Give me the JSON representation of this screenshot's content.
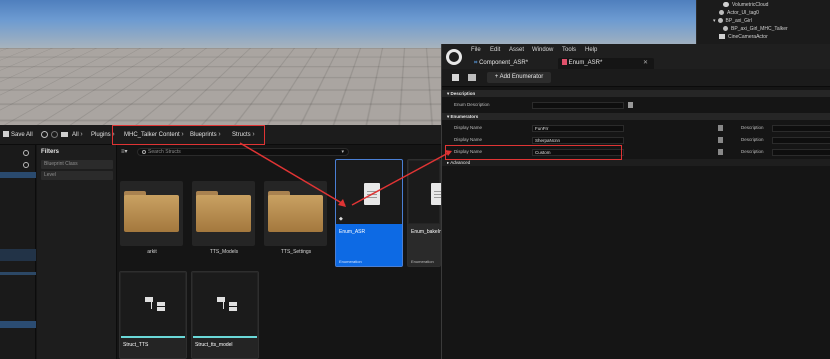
{
  "outliner": {
    "items": [
      {
        "label": "VolumetricCloud"
      },
      {
        "label": "Actor_UI_tag0"
      },
      {
        "label": "BP_axi_Girl"
      },
      {
        "label": "BP_axi_Girl_MHC_Talker"
      },
      {
        "label": "CineCameraActor"
      }
    ]
  },
  "content_browser": {
    "save_all": "Save All",
    "breadcrumb": [
      "All",
      "Plugins",
      "MHC_Talker Content",
      "Blueprints",
      "Structs"
    ],
    "filters_title": "Filters",
    "filter_items": [
      "Blueprint Class",
      "Level"
    ],
    "search_placeholder": "Search Structs",
    "folders": [
      {
        "label": "arkit"
      },
      {
        "label": "TTS_Models"
      },
      {
        "label": "TTS_Settings"
      }
    ],
    "assets": [
      {
        "name": "Enum_ASR",
        "type": "Enumeration",
        "selected": true
      },
      {
        "name": "Enum_bakeInf",
        "type": "Enumeration",
        "selected": false
      },
      {
        "name": "Struct_TTS",
        "type": "",
        "selected": false
      },
      {
        "name": "Struct_tts_model",
        "type": "",
        "selected": false
      }
    ]
  },
  "editor": {
    "menu": [
      "File",
      "Edit",
      "Asset",
      "Window",
      "Tools",
      "Help"
    ],
    "tabs": [
      {
        "label": "Component_ASR*"
      },
      {
        "label": "Enum_ASR*"
      }
    ],
    "add_button": "+ Add Enumerator",
    "sections": {
      "description": "Description",
      "enumerators": "Enumerators",
      "advanced": "Advanced"
    },
    "enum_description_label": "Enum Description",
    "display_name_label": "Display Name",
    "description_label": "Description",
    "enumerators": [
      {
        "display_name": "FunFrr"
      },
      {
        "display_name": "SherpaNcnn"
      },
      {
        "display_name": "Custom"
      }
    ]
  },
  "colors": {
    "accent": "#0d6ae4",
    "highlight": "#e03434",
    "folder": "#c09a5e"
  }
}
